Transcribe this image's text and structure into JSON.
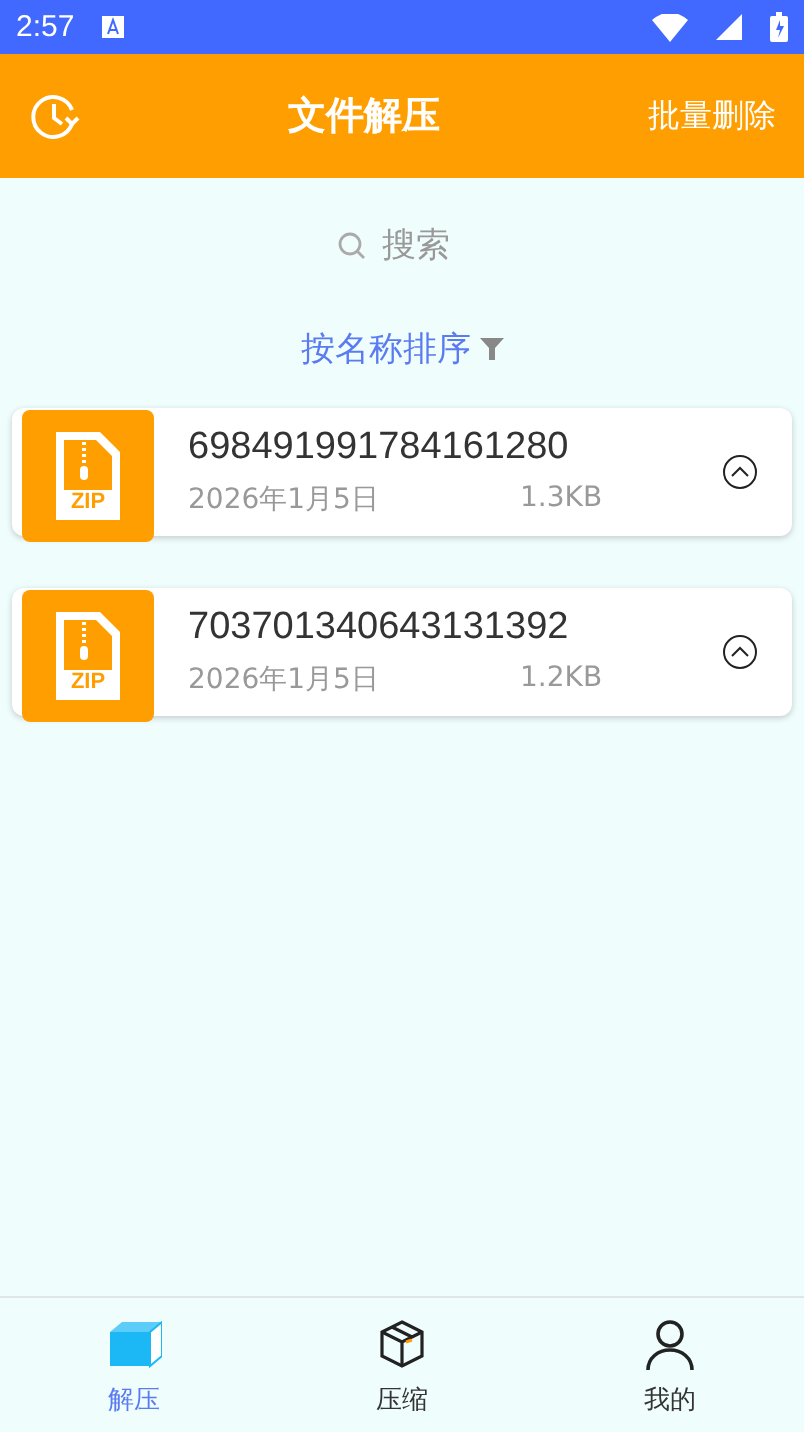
{
  "status_bar": {
    "time": "2:57"
  },
  "header": {
    "title": "文件解压",
    "action": "批量删除"
  },
  "search": {
    "placeholder": "搜索"
  },
  "sort": {
    "label": "按名称排序"
  },
  "files": [
    {
      "name": "698491991784161280",
      "date": "2026年1月5日",
      "size": "1.3KB",
      "type_label": "ZIP"
    },
    {
      "name": "703701340643131392",
      "date": "2026年1月5日",
      "size": "1.2KB",
      "type_label": "ZIP"
    }
  ],
  "tabs": [
    {
      "label": "解压",
      "kind": "extract",
      "selected": true
    },
    {
      "label": "压缩",
      "kind": "compress",
      "selected": false
    },
    {
      "label": "我的",
      "kind": "profile",
      "selected": false
    }
  ]
}
